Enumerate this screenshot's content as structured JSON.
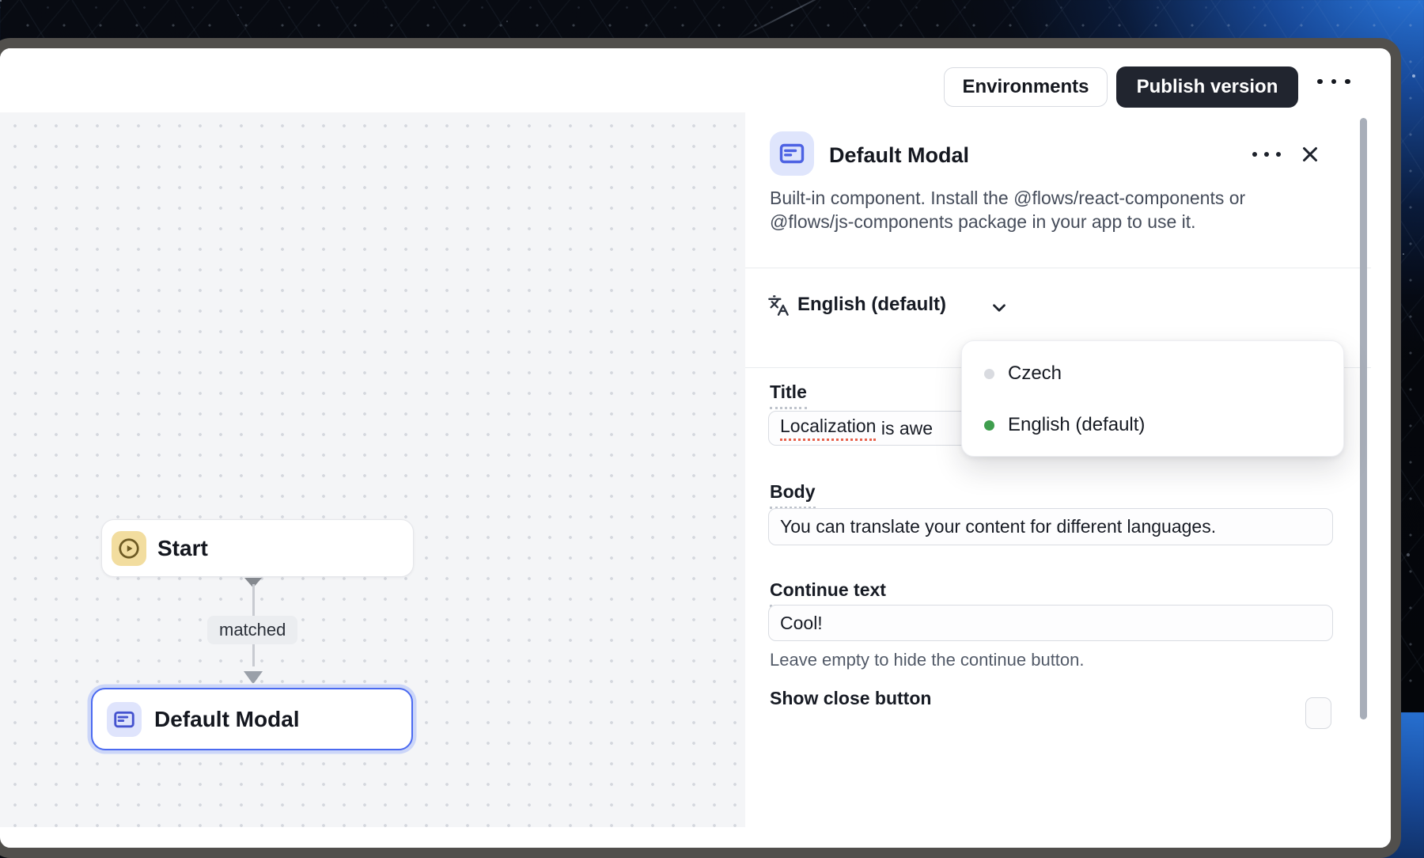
{
  "header": {
    "environments_label": "Environments",
    "publish_label": "Publish version"
  },
  "canvas": {
    "start_node": {
      "label": "Start"
    },
    "edge_label": "matched",
    "modal_node": {
      "label": "Default Modal"
    }
  },
  "panel": {
    "title": "Default Modal",
    "description": "Built-in component. Install the @flows/react-components or @flows/js-components package in your app to use it.",
    "language_selector": {
      "value": "English (default)"
    },
    "language_dropdown": {
      "items": [
        {
          "label": "Czech",
          "status_color": "#d9dbe0"
        },
        {
          "label": "English (default)",
          "status_color": "#3f9e4e"
        }
      ]
    },
    "fields": {
      "title": {
        "label": "Title",
        "misspelled_word": "Localization",
        "value_rest": " is awe"
      },
      "body": {
        "label": "Body",
        "value": "You can translate your content for different languages."
      },
      "continue_text": {
        "label": "Continue text",
        "value": "Cool!",
        "helper": "Leave empty to hide the continue button."
      },
      "show_close_button": {
        "label": "Show close button"
      }
    }
  },
  "colors": {
    "accent_blue": "#4b6af0",
    "selected_ring": "#c9d4fb",
    "icon_lavender_bg": "#dfe5fc",
    "icon_amber_bg": "#f2dd9f",
    "green_status": "#3f9e4e",
    "gray_status": "#d9dbe0",
    "publish_button_bg": "#21252f",
    "canvas_bg": "#f4f5f7",
    "frame": "#514f4c",
    "spellcheck_red": "#e8614b"
  }
}
